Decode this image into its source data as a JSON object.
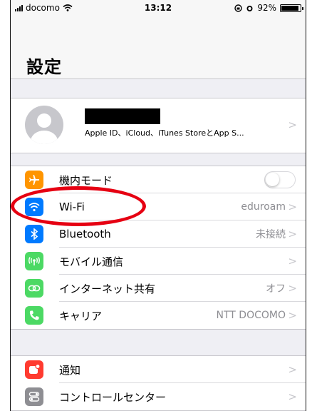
{
  "status_bar": {
    "carrier": "docomo",
    "time": "13:12",
    "battery": "92%",
    "battery_level": 0.92
  },
  "nav": {
    "title": "設定"
  },
  "profile": {
    "subtitle": "Apple ID、iCloud、iTunes StoreとApp S...",
    "name_redacted": true
  },
  "groups": {
    "network": [
      {
        "id": "airplane",
        "label": "機内モード",
        "icon": "airplane-icon",
        "color": "#ff9500",
        "toggle": "off"
      },
      {
        "id": "wifi",
        "label": "Wi-Fi",
        "value": "eduroam",
        "icon": "wifi-icon",
        "color": "#007aff"
      },
      {
        "id": "bluetooth",
        "label": "Bluetooth",
        "value": "未接続",
        "icon": "bluetooth-icon",
        "color": "#007aff"
      },
      {
        "id": "cellular",
        "label": "モバイル通信",
        "value": "",
        "icon": "cellular-icon",
        "color": "#4cd964"
      },
      {
        "id": "hotspot",
        "label": "インターネット共有",
        "value": "オフ",
        "icon": "hotspot-icon",
        "color": "#4cd964"
      },
      {
        "id": "carrier",
        "label": "キャリア",
        "value": "NTT DOCOMO",
        "icon": "phone-icon",
        "color": "#4cd964"
      }
    ],
    "system": [
      {
        "id": "notifications",
        "label": "通知",
        "icon": "notifications-icon",
        "color": "#ff3b30"
      },
      {
        "id": "control_center",
        "label": "コントロールセンター",
        "icon": "control-center-icon",
        "color": "#8e8e93"
      }
    ]
  },
  "annotation": {
    "highlight_color": "#e60012",
    "target": "wifi"
  }
}
